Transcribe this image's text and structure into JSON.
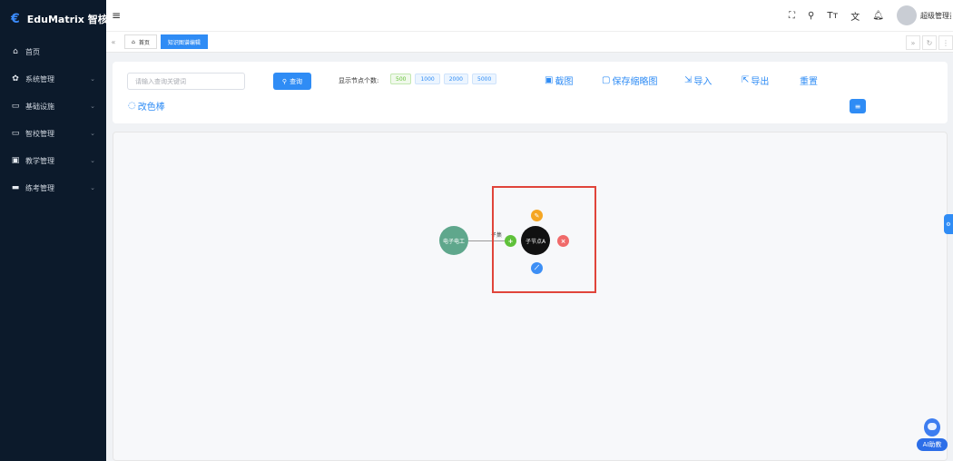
{
  "app": {
    "logo_text": "EduMatrix 智核"
  },
  "sidebar": {
    "items": [
      {
        "label": "首页",
        "icon": "home-icon",
        "expandable": false
      },
      {
        "label": "系统管理",
        "icon": "gear-icon",
        "expandable": true
      },
      {
        "label": "基础设施",
        "icon": "monitor-icon",
        "expandable": true
      },
      {
        "label": "智校管理",
        "icon": "monitor-icon",
        "expandable": true
      },
      {
        "label": "教学管理",
        "icon": "calendar-icon",
        "expandable": true
      },
      {
        "label": "练考管理",
        "icon": "keyboard-icon",
        "expandable": true
      }
    ]
  },
  "header": {
    "menu_glyph": "≡",
    "icons": [
      "fullscreen-icon",
      "search-icon",
      "font-size-icon",
      "translate-icon",
      "bell-icon"
    ],
    "username": "超级管理员"
  },
  "tabs": {
    "items": [
      {
        "label": "首页",
        "active": false
      },
      {
        "label": "知识图谱编辑",
        "active": true
      }
    ]
  },
  "toolbar": {
    "search_placeholder": "请输入查询关键词",
    "search_value": "",
    "search_button": "查询",
    "count_label": "显示节点个数:",
    "count_options": [
      {
        "label": "500",
        "active": true
      },
      {
        "label": "1000",
        "active": false
      },
      {
        "label": "2000",
        "active": false
      },
      {
        "label": "5000",
        "active": false
      }
    ],
    "screenshot": "截图",
    "save_thumbnail": "保存缩略图",
    "import": "导入",
    "export": "导出",
    "reset": "重置",
    "palette": "改色棒"
  },
  "graph": {
    "main_node": "电子电工",
    "child_node": "子节点A",
    "edge_label": "子集",
    "colors": {
      "main": "#5fa78c",
      "child": "#111111",
      "add": "#5fc13a",
      "edit": "#f5a623",
      "delete": "#f06a6a",
      "link": "#3d8ff5",
      "highlight": "#e0443a"
    }
  },
  "ai_helper": {
    "label": "AI助教"
  }
}
